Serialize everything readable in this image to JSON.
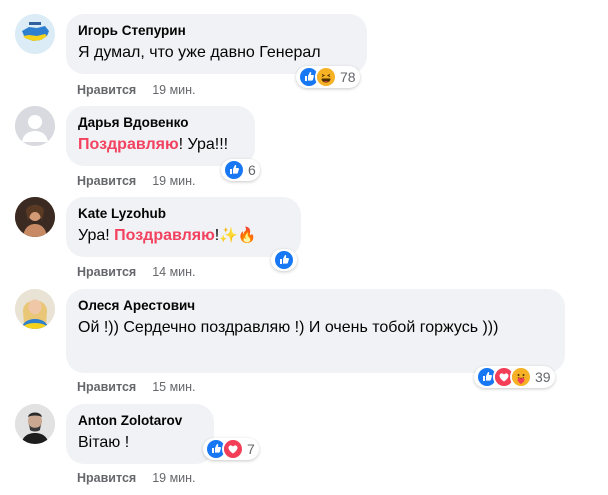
{
  "colors": {
    "bubble_bg": "#f0f2f5",
    "highlight": "#f3425f",
    "meta_text": "#65676b",
    "like_blue": "#1877f2",
    "love_red": "#f33e58",
    "haha_yellow": "#f7b125"
  },
  "comments": [
    {
      "author": "Игорь Степурин",
      "text": "Я думал, что уже давно Генерал",
      "like_label": "Нравится",
      "time": "19 мин.",
      "reaction_icons": [
        "like-icon",
        "haha-icon"
      ],
      "reaction_count": "78"
    },
    {
      "author": "Дарья Вдовенко",
      "text_highlight": "Поздравляю",
      "text_rest": "! Ура!!!",
      "like_label": "Нравится",
      "time": "19 мин.",
      "reaction_icons": [
        "like-icon"
      ],
      "reaction_count": "6"
    },
    {
      "author": "Kate Lyzohub",
      "text_pre": "Ура! ",
      "text_highlight": "Поздравляю",
      "text_post": "!",
      "emoji": "✨🔥",
      "like_label": "Нравится",
      "time": "14 мин.",
      "reaction_icons": [
        "like-icon"
      ]
    },
    {
      "author": "Олеся Арестович",
      "text": "Ой !)) Сердечно поздравляю !) И очень тобой горжусь )))",
      "like_label": "Нравится",
      "time": "15 мин.",
      "reaction_icons": [
        "like-icon",
        "love-icon",
        "care-icon"
      ],
      "reaction_count": "39"
    },
    {
      "author": "Anton Zolotarov",
      "text": "Вітаю !",
      "like_label": "Нравится",
      "time": "19 мин.",
      "reaction_icons": [
        "like-icon",
        "love-icon"
      ],
      "reaction_count": "7"
    }
  ]
}
